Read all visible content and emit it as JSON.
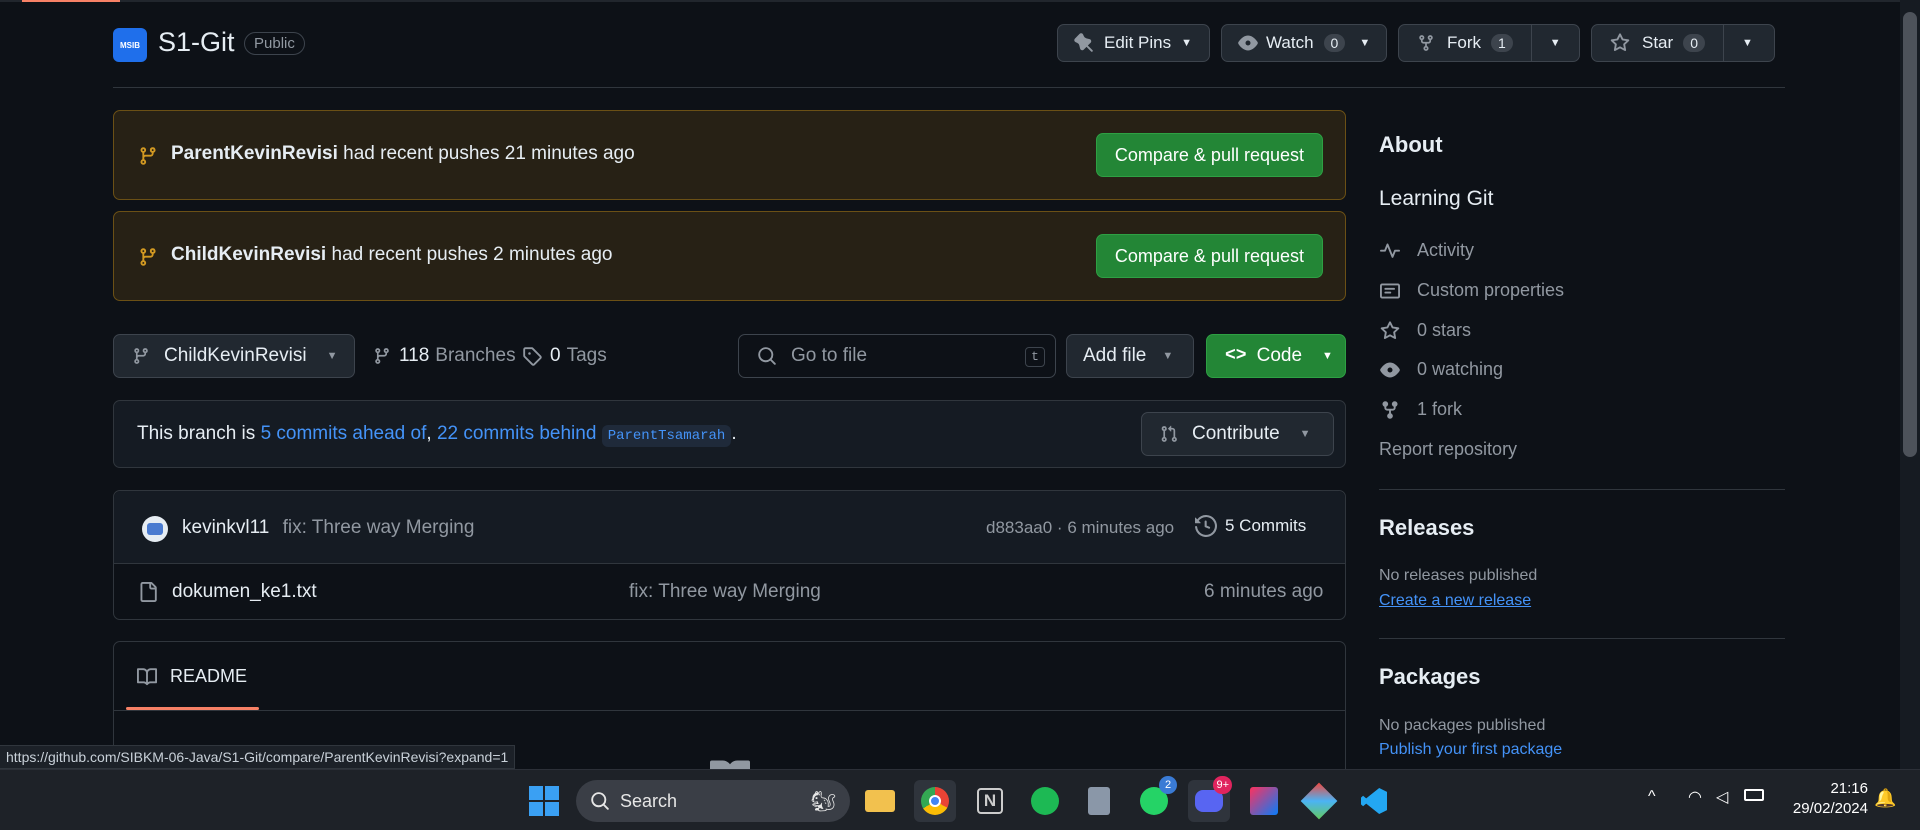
{
  "repo": {
    "name": "S1-Git",
    "visibility": "Public",
    "logo_text": "MSIB"
  },
  "header_buttons": {
    "edit_pins": "Edit Pins",
    "watch": "Watch",
    "watch_count": "0",
    "fork": "Fork",
    "fork_count": "1",
    "star": "Star",
    "star_count": "0"
  },
  "banners": [
    {
      "branch": "ParentKevinRevisi",
      "text": "had recent pushes 21 minutes ago",
      "button": "Compare & pull request"
    },
    {
      "branch": "ChildKevinRevisi",
      "text": "had recent pushes 2 minutes ago",
      "button": "Compare & pull request"
    }
  ],
  "branch_bar": {
    "current_branch": "ChildKevinRevisi",
    "branches_count": "118",
    "branches_label": "Branches",
    "tags_count": "0",
    "tags_label": "Tags",
    "search_placeholder": "Go to file",
    "search_key": "t",
    "add_file": "Add file",
    "code": "Code"
  },
  "compare": {
    "prefix": "This branch is",
    "ahead": "5 commits ahead of",
    "comma": ",",
    "behind": "22 commits behind",
    "base": "ParentTsamarah",
    "suffix": ".",
    "contribute": "Contribute"
  },
  "latest_commit": {
    "author": "kevinkvl11",
    "message": "fix: Three way Merging",
    "hash": "d883aa0",
    "dot": "·",
    "time": "6 minutes ago",
    "commits_label": "5 Commits"
  },
  "files": [
    {
      "name": "dokumen_ke1.txt",
      "message": "fix: Three way Merging",
      "time": "6 minutes ago"
    }
  ],
  "readme_tab": "README",
  "sidebar": {
    "about_title": "About",
    "description": "Learning Git",
    "items": [
      {
        "label": "Activity",
        "icon": "pulse-icon"
      },
      {
        "label": "Custom properties",
        "icon": "note-icon"
      },
      {
        "label": "0 stars",
        "icon": "star-icon"
      },
      {
        "label": "0 watching",
        "icon": "eye-icon"
      },
      {
        "label": "1 fork",
        "icon": "fork-icon"
      }
    ],
    "report": "Report repository",
    "releases_title": "Releases",
    "releases_none": "No releases published",
    "releases_link": "Create a new release",
    "packages_title": "Packages",
    "packages_none": "No packages published",
    "packages_link": "Publish your first package"
  },
  "status_url": "https://github.com/SIBKM-06-Java/S1-Git/compare/ParentKevinRevisi?expand=1",
  "taskbar": {
    "search": "Search",
    "whatsapp_badge": "2",
    "discord_badge": "9+",
    "time": "21:16",
    "date": "29/02/2024"
  },
  "colors": {
    "accent_green": "#238636",
    "link_blue": "#4493f8",
    "banner_bg": "#272115"
  }
}
